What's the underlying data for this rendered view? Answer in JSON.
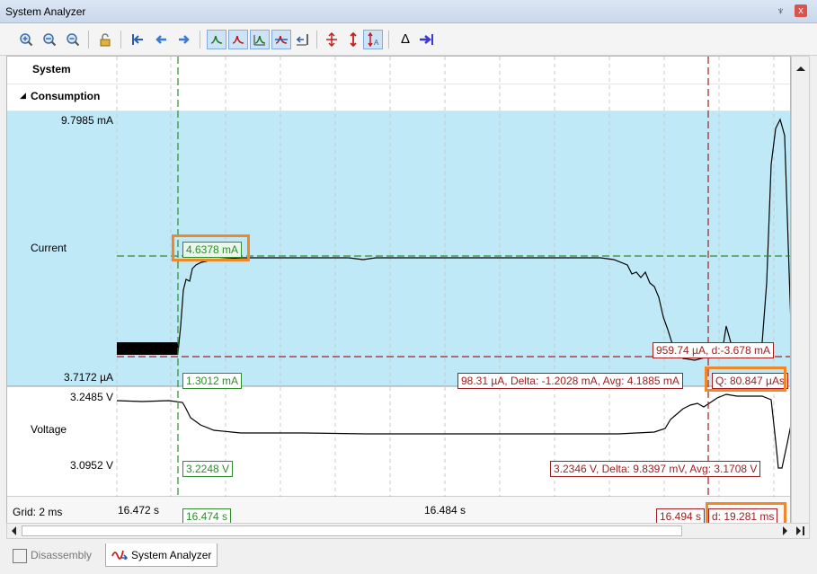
{
  "window": {
    "title": "System Analyzer",
    "pin_glyph": "♆",
    "close_glyph": "x"
  },
  "toolbar": {
    "icons": [
      "zoom-in-icon",
      "zoom-fit-icon",
      "zoom-out-icon",
      "lock-icon",
      "cursor-left-jump-icon",
      "scroll-left-icon",
      "scroll-right-icon",
      "trigger-rising-icon",
      "trigger-falling-icon",
      "trigger-both-icon",
      "trigger-off-icon",
      "marker-icon",
      "expand-vertical-icon",
      "auto-scale-icon",
      "auto-scale-a-icon",
      "delta-icon",
      "jump-end-icon"
    ],
    "delta_glyph": "Δ"
  },
  "tree": {
    "system": "System",
    "consumption": "Consumption"
  },
  "current": {
    "label": "Current",
    "max": "9.7985 mA",
    "min": "3.7172 µA",
    "cursor1_value": "4.6378 mA",
    "cursor1_low": "1.3012 mA",
    "cursor2_value": "959.74 µA, d:-3.678 mA",
    "cursor2_stats": "98.31 µA, Delta: -1.2028 mA, Avg: 4.1885 mA",
    "charge": "Q: 80.847 µAs"
  },
  "voltage": {
    "label": "Voltage",
    "max": "3.2485 V",
    "min": "3.0952 V",
    "cursor1_value": "3.2248 V",
    "cursor2_stats": "3.2346 V, Delta: 9.8397 mV, Avg: 3.1708 V"
  },
  "axis": {
    "grid": "Grid: 2 ms",
    "t0": "16.472 s",
    "cursor1_time": "16.474 s",
    "t_mid": "16.484 s",
    "cursor2_time": "16.494 s",
    "delta_time": "d: 19.281 ms"
  },
  "tabs": {
    "disassembly": "Disassembly",
    "system_analyzer": "System Analyzer"
  },
  "colors": {
    "current_bg": "#bfe9f7",
    "cursor1": "#2e8b2e",
    "cursor2": "#a02020",
    "highlight": "#f0882a"
  }
}
